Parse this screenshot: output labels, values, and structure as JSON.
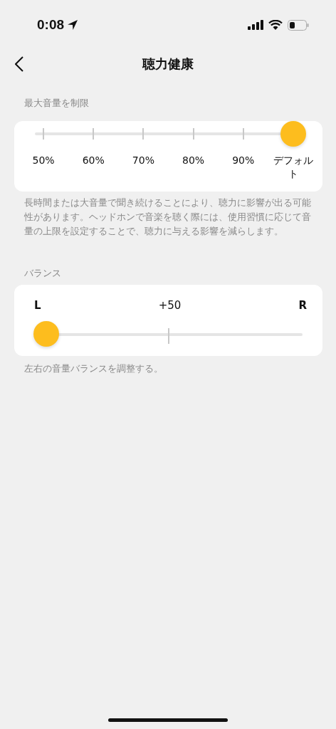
{
  "status_bar": {
    "time": "0:08"
  },
  "nav": {
    "title": "聴力健康"
  },
  "volume_limit": {
    "label": "最大音量を制限",
    "level": 1,
    "stops": [
      "50%",
      "60%",
      "70%",
      "80%",
      "90%",
      "デフォルト"
    ],
    "description": "長時間または大音量で聞き続けることにより、聴力に影響が出る可能性があります。ヘッドホンで音楽を聴く際には、使用習慣に応じて音量の上限を設定することで、聴力に与える影響を減らします。"
  },
  "balance": {
    "label": "バランス",
    "left": "L",
    "value": "+50",
    "right": "R",
    "level": 0,
    "description": "左右の音量バランスを調整する。"
  }
}
